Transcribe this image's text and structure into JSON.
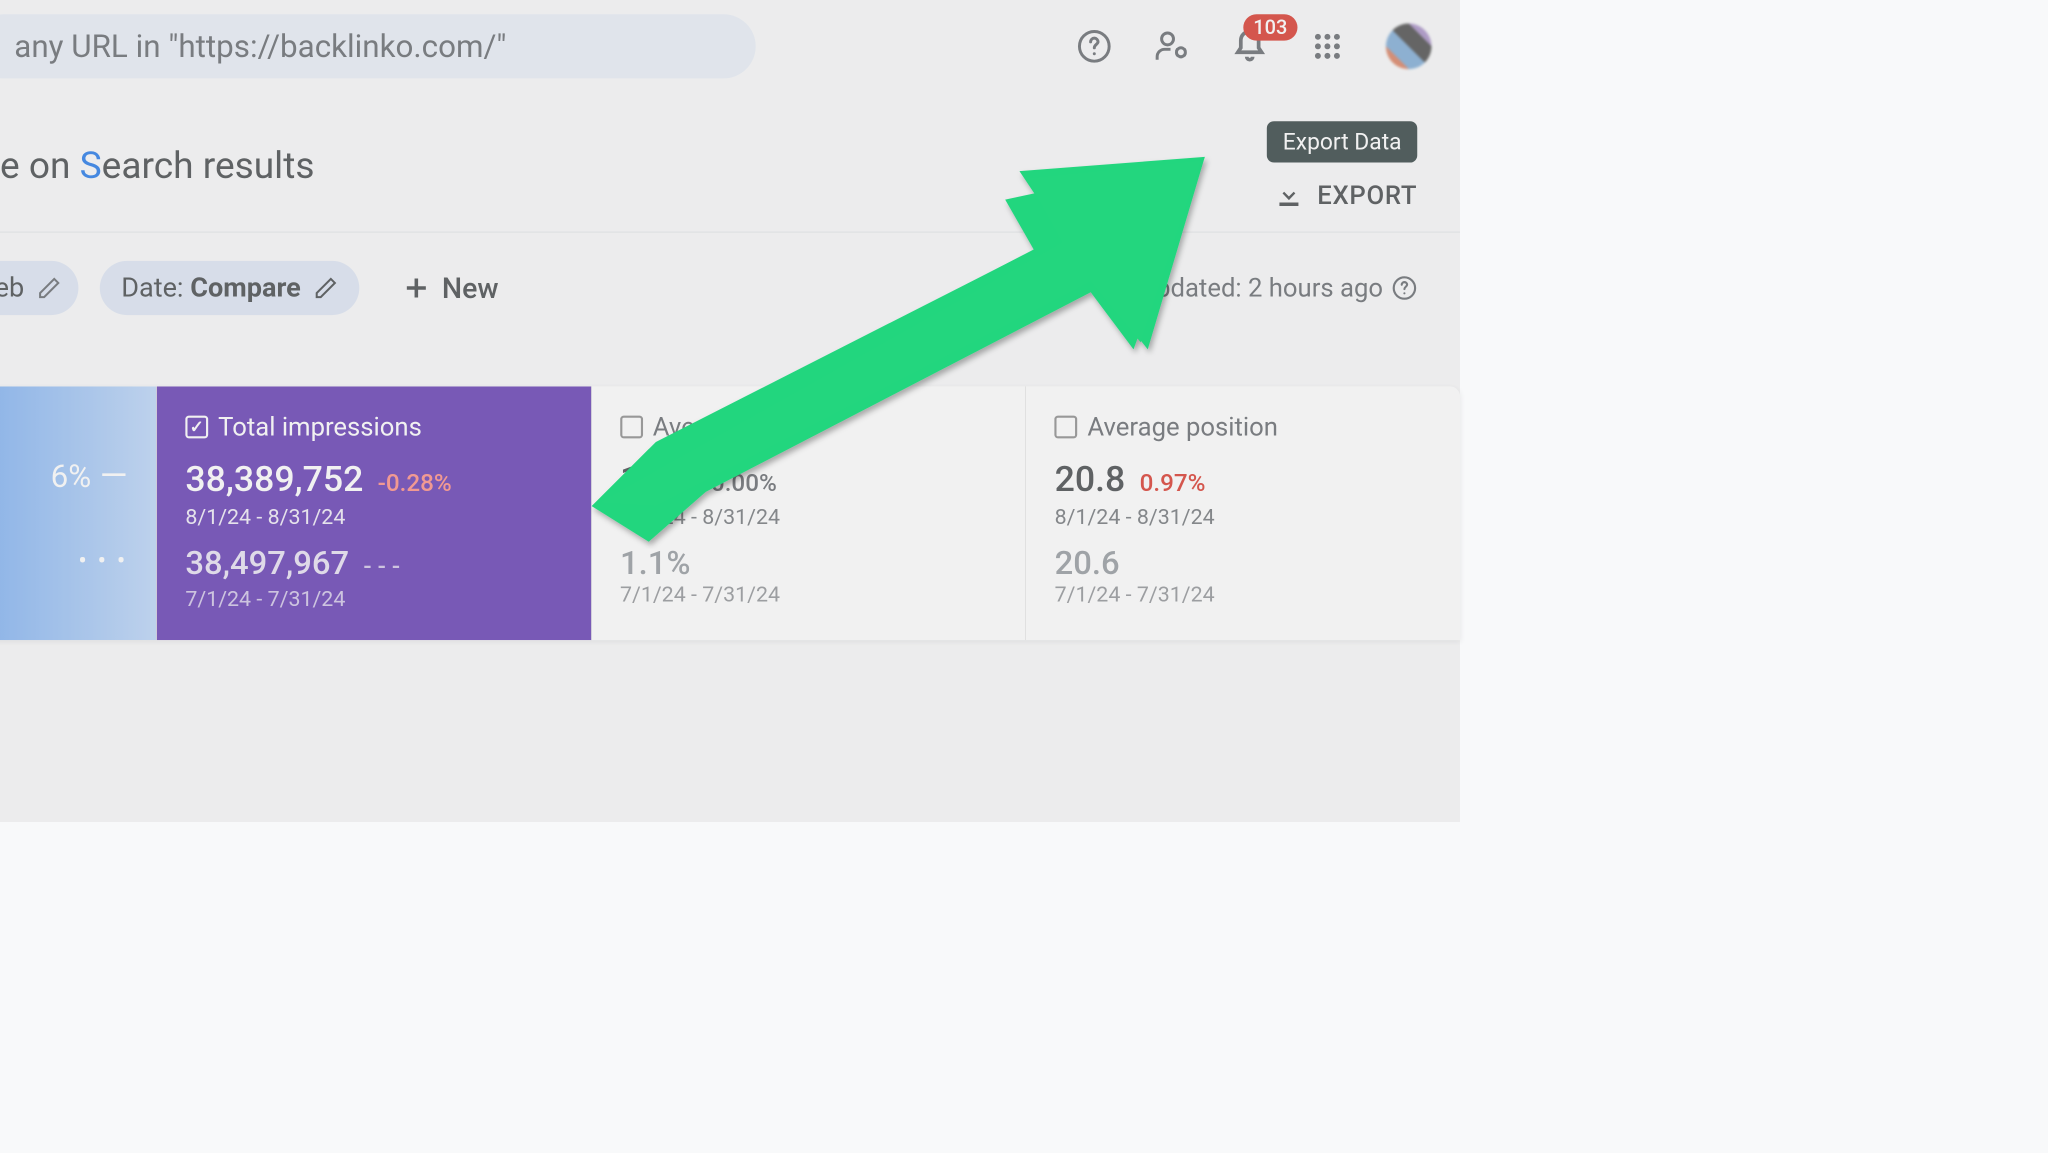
{
  "search": {
    "placeholder": "any URL in \"https://backlinko.com/\""
  },
  "notifications": {
    "count": "103"
  },
  "page": {
    "title_pre": "e on ",
    "title_hl": "S",
    "title_post": "earch results"
  },
  "export": {
    "tooltip": "Export Data",
    "label": "EXPORT"
  },
  "filters": {
    "partial_label": "eb",
    "date_label": "Date: ",
    "date_value": "Compare",
    "new_label": "New",
    "updated": "updated: 2 hours ago"
  },
  "metrics": {
    "clicks": {
      "partial_val": "6%",
      "minus": "—",
      "dots": "• • •"
    },
    "impressions": {
      "label": "Total impressions",
      "val1": "38,389,752",
      "delta1": "-0.28%",
      "date1": "8/1/24 - 8/31/24",
      "val2": "38,497,967",
      "delta2": "- - -",
      "date2": "7/1/24 - 7/31/24"
    },
    "ctr": {
      "label": "Average CTR",
      "val1": "1.1%",
      "delta1": "0.00%",
      "date1": "8/1/24 - 8/31/24",
      "val2": "1.1%",
      "date2": "7/1/24 - 7/31/24"
    },
    "position": {
      "label": "Average position",
      "val1": "20.8",
      "delta1": "0.97%",
      "date1": "8/1/24 - 8/31/24",
      "val2": "20.6",
      "date2": "7/1/24 - 7/31/24"
    }
  }
}
